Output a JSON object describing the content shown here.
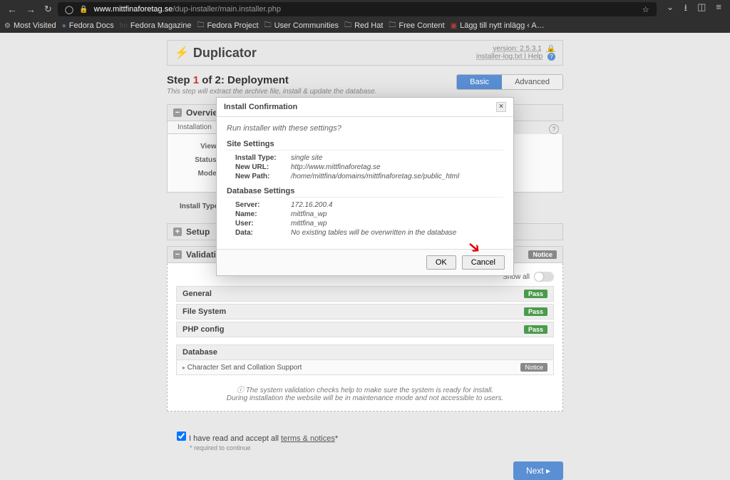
{
  "browser": {
    "url_domain": "www.mittfinaforetag.se",
    "url_path": "/dup-installer/main.installer.php",
    "bookmarks": [
      {
        "label": "Most Visited",
        "icon": "⚙"
      },
      {
        "label": "Fedora Docs",
        "icon": "●",
        "color": "#4f8fd6"
      },
      {
        "label": "Fedora Magazine",
        "icon": "fm",
        "color": "#555"
      },
      {
        "label": "Fedora Project",
        "icon": "🗀"
      },
      {
        "label": "User Communities",
        "icon": "🗀"
      },
      {
        "label": "Red Hat",
        "icon": "🗀"
      },
      {
        "label": "Free Content",
        "icon": "🗀"
      },
      {
        "label": "Lägg till nytt inlägg ‹ A…",
        "icon": "▣",
        "color": "#d44"
      }
    ]
  },
  "duplicator": {
    "title": "Duplicator",
    "version": "version: 2.5.3.1",
    "links": "installer-log.txt  |  Help",
    "step_title_pre": "Step ",
    "step_num": "1",
    "step_title_post": " of 2: Deployment",
    "step_sub": "This step will extract the archive file, install & update the database.",
    "basic": "Basic",
    "advanced": "Advanced",
    "overview": "Overview",
    "installation_tab": "Installation",
    "labels": {
      "view": "View:",
      "status": "Status:",
      "mode": "Mode:",
      "install_type": "Install Type:"
    },
    "setup": "Setup",
    "validation": "Validation",
    "show_all": "Show all",
    "rows": {
      "general": "General",
      "filesystem": "File System",
      "php": "PHP config",
      "database": "Database",
      "charset": "Character Set and Collation Support"
    },
    "pass": "Pass",
    "notice": "Notice",
    "note1": "The system validation checks help to make sure the system is ready for install.",
    "note2": "During installation the website will be in maintenance mode and not accessible to users.",
    "accept_pre": "I have read and accept all ",
    "accept_link": "terms & notices",
    "accept_post": "*",
    "required": "* required to continue",
    "next": "Next ▸"
  },
  "modal": {
    "title": "Install Confirmation",
    "question": "Run installer with these settings?",
    "site_h": "Site Settings",
    "db_h": "Database Settings",
    "site": [
      {
        "k": "Install Type:",
        "v": "single site"
      },
      {
        "k": "New URL:",
        "v": "http://www.mittfinaforetag.se"
      },
      {
        "k": "New Path:",
        "v": "/home/mittfina/domains/mittfinaforetag.se/public_html"
      }
    ],
    "db": [
      {
        "k": "Server:",
        "v": "172.16.200.4"
      },
      {
        "k": "Name:",
        "v": "mittfina_wp"
      },
      {
        "k": "User:",
        "v": "mittfina_wp"
      },
      {
        "k": "Data:",
        "v": "No existing tables will be overwritten in the database"
      }
    ],
    "ok": "OK",
    "cancel": "Cancel"
  }
}
